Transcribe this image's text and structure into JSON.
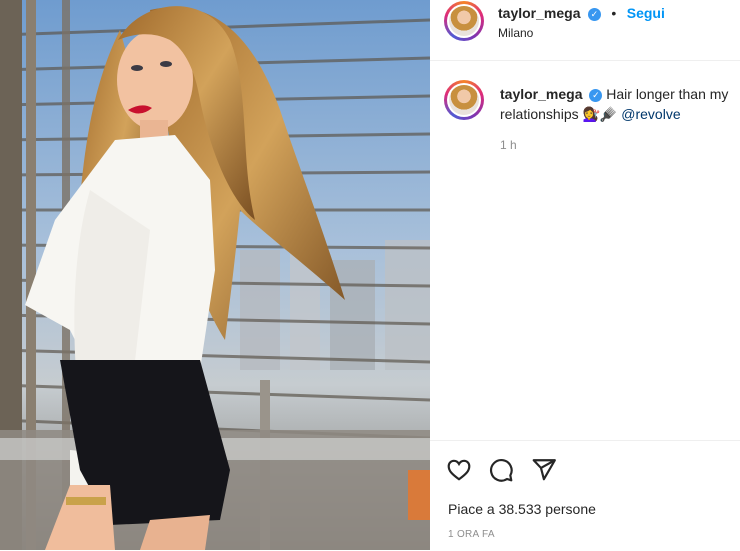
{
  "post": {
    "username": "taylor_mega",
    "verified_mark": "✓",
    "separator": "•",
    "follow_label": "Segui",
    "location": "Milano"
  },
  "caption": {
    "username": "taylor_mega",
    "text": "Hair longer than my relationships",
    "emoji": "💇‍♀️🪮",
    "mention": "@revolve",
    "time": "1 h"
  },
  "actions": {
    "like_icon": "heart-icon",
    "comment_icon": "comment-icon",
    "share_icon": "share-icon",
    "likes_text": "Piace a 38.533 persone",
    "posted_ago": "1 ORA FA"
  },
  "colors": {
    "accent": "#0095f6",
    "verified": "#3897f0",
    "mention": "#00376b",
    "muted": "#8e8e8e"
  }
}
